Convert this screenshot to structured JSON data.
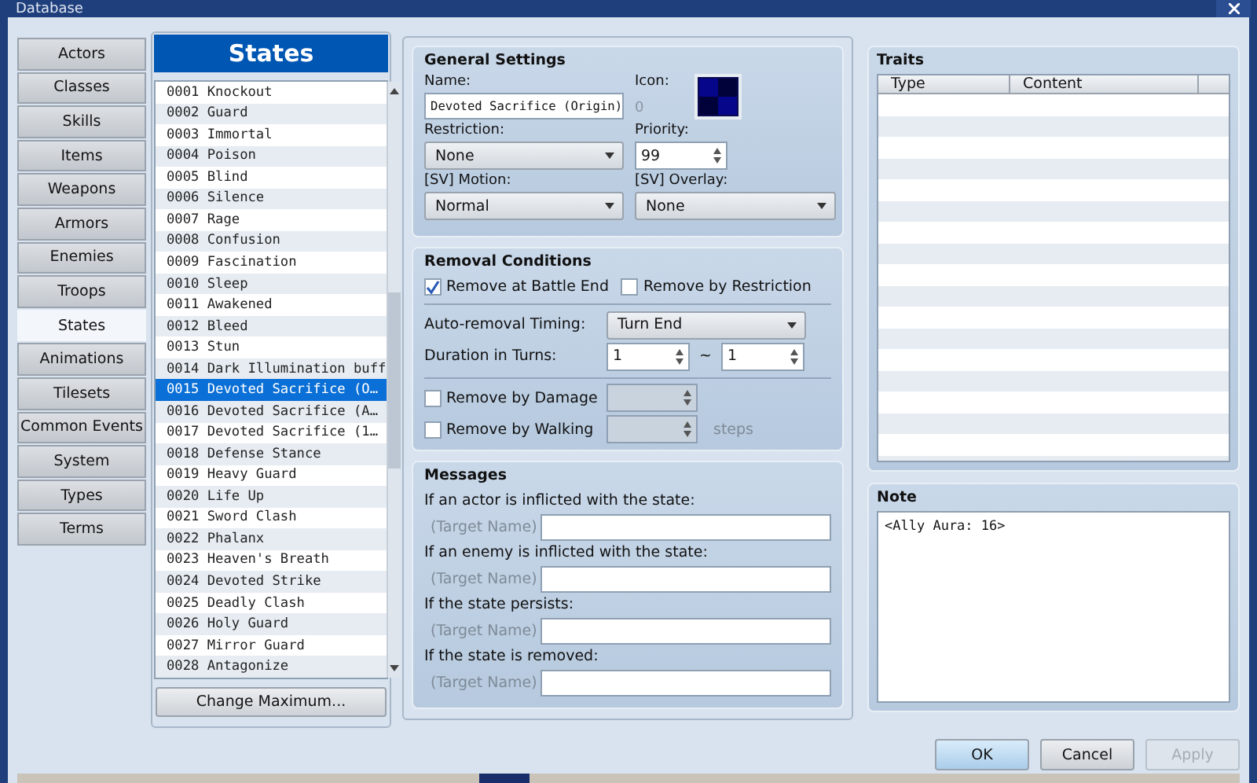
{
  "window": {
    "title": "Database"
  },
  "categories": [
    {
      "label": "Actors",
      "selected": false
    },
    {
      "label": "Classes",
      "selected": false
    },
    {
      "label": "Skills",
      "selected": false
    },
    {
      "label": "Items",
      "selected": false
    },
    {
      "label": "Weapons",
      "selected": false
    },
    {
      "label": "Armors",
      "selected": false
    },
    {
      "label": "Enemies",
      "selected": false
    },
    {
      "label": "Troops",
      "selected": false
    },
    {
      "label": "States",
      "selected": true
    },
    {
      "label": "Animations",
      "selected": false
    },
    {
      "label": "Tilesets",
      "selected": false
    },
    {
      "label": "Common Events",
      "selected": false
    },
    {
      "label": "System",
      "selected": false
    },
    {
      "label": "Types",
      "selected": false
    },
    {
      "label": "Terms",
      "selected": false
    }
  ],
  "states_list": {
    "title": "States",
    "items": [
      {
        "label": "0001 Knockout",
        "selected": false
      },
      {
        "label": "0002 Guard",
        "selected": false
      },
      {
        "label": "0003 Immortal",
        "selected": false
      },
      {
        "label": "0004 Poison",
        "selected": false
      },
      {
        "label": "0005 Blind",
        "selected": false
      },
      {
        "label": "0006 Silence",
        "selected": false
      },
      {
        "label": "0007 Rage",
        "selected": false
      },
      {
        "label": "0008 Confusion",
        "selected": false
      },
      {
        "label": "0009 Fascination",
        "selected": false
      },
      {
        "label": "0010 Sleep",
        "selected": false
      },
      {
        "label": "0011 Awakened",
        "selected": false
      },
      {
        "label": "0012 Bleed",
        "selected": false
      },
      {
        "label": "0013 Stun",
        "selected": false
      },
      {
        "label": "0014 Dark Illumination buff",
        "selected": false
      },
      {
        "label": "0015 Devoted Sacrifice (O…",
        "selected": true
      },
      {
        "label": "0016 Devoted Sacrifice (A…",
        "selected": false
      },
      {
        "label": "0017 Devoted Sacrifice (1…",
        "selected": false
      },
      {
        "label": "0018 Defense Stance",
        "selected": false
      },
      {
        "label": "0019 Heavy Guard",
        "selected": false
      },
      {
        "label": "0020 Life Up",
        "selected": false
      },
      {
        "label": "0021 Sword Clash",
        "selected": false
      },
      {
        "label": "0022 Phalanx",
        "selected": false
      },
      {
        "label": "0023 Heaven's Breath",
        "selected": false
      },
      {
        "label": "0024 Devoted Strike",
        "selected": false
      },
      {
        "label": "0025 Deadly Clash",
        "selected": false
      },
      {
        "label": "0026 Holy Guard",
        "selected": false
      },
      {
        "label": "0027 Mirror Guard",
        "selected": false
      },
      {
        "label": "0028 Antagonize",
        "selected": false
      }
    ],
    "button": "Change Maximum..."
  },
  "general_settings": {
    "title": "General Settings",
    "name_label": "Name:",
    "name_value": "Devoted Sacrifice (Origin)",
    "icon_label": "Icon:",
    "icon_index": "0",
    "restriction_label": "Restriction:",
    "restriction_value": "None",
    "priority_label": "Priority:",
    "priority_value": "99",
    "motion_label": "[SV] Motion:",
    "motion_value": "Normal",
    "overlay_label": "[SV] Overlay:",
    "overlay_value": "None"
  },
  "removal_conditions": {
    "title": "Removal Conditions",
    "checks": [
      {
        "label": "Remove at Battle End",
        "checked": true
      },
      {
        "label": "Remove by Restriction",
        "checked": false
      }
    ],
    "timing_label": "Auto-removal Timing:",
    "timing_value": "Turn End",
    "duration_label": "Duration in Turns:",
    "duration_min": "1",
    "duration_separator": "~",
    "duration_max": "1",
    "damage": {
      "label": "Remove by Damage",
      "checked": false
    },
    "walking": {
      "label": "Remove by Walking",
      "checked": false,
      "unit": "steps"
    }
  },
  "messages": {
    "title": "Messages",
    "items": [
      {
        "label": "If an actor is inflicted with the state:",
        "prefix": "(Target Name)"
      },
      {
        "label": "If an enemy is inflicted with the state:",
        "prefix": "(Target Name)"
      },
      {
        "label": "If the state persists:",
        "prefix": "(Target Name)"
      },
      {
        "label": "If the state is removed:",
        "prefix": "(Target Name)"
      }
    ]
  },
  "traits": {
    "title": "Traits",
    "columns": [
      "Type",
      "Content"
    ]
  },
  "note": {
    "title": "Note",
    "value": "<Ally Aura: 16>"
  },
  "buttons": [
    {
      "label": "OK",
      "default": true,
      "disabled": false
    },
    {
      "label": "Cancel",
      "default": false,
      "disabled": false
    },
    {
      "label": "Apply",
      "default": false,
      "disabled": true
    }
  ]
}
